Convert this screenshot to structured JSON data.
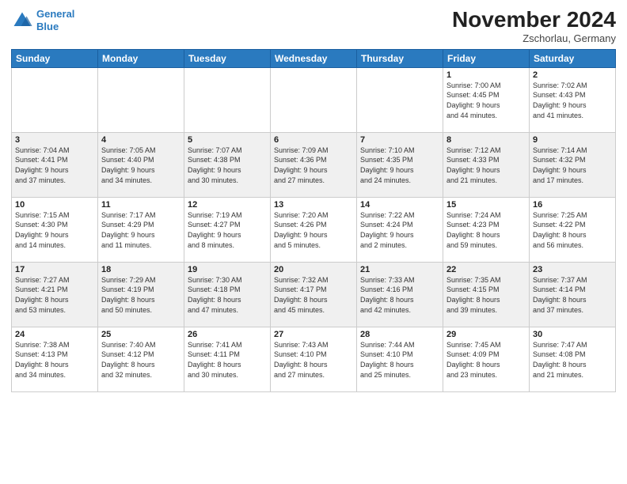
{
  "header": {
    "logo_line1": "General",
    "logo_line2": "Blue",
    "month_title": "November 2024",
    "location": "Zschorlau, Germany"
  },
  "weekdays": [
    "Sunday",
    "Monday",
    "Tuesday",
    "Wednesday",
    "Thursday",
    "Friday",
    "Saturday"
  ],
  "weeks": [
    [
      {
        "day": "",
        "info": ""
      },
      {
        "day": "",
        "info": ""
      },
      {
        "day": "",
        "info": ""
      },
      {
        "day": "",
        "info": ""
      },
      {
        "day": "",
        "info": ""
      },
      {
        "day": "1",
        "info": "Sunrise: 7:00 AM\nSunset: 4:45 PM\nDaylight: 9 hours\nand 44 minutes."
      },
      {
        "day": "2",
        "info": "Sunrise: 7:02 AM\nSunset: 4:43 PM\nDaylight: 9 hours\nand 41 minutes."
      }
    ],
    [
      {
        "day": "3",
        "info": "Sunrise: 7:04 AM\nSunset: 4:41 PM\nDaylight: 9 hours\nand 37 minutes."
      },
      {
        "day": "4",
        "info": "Sunrise: 7:05 AM\nSunset: 4:40 PM\nDaylight: 9 hours\nand 34 minutes."
      },
      {
        "day": "5",
        "info": "Sunrise: 7:07 AM\nSunset: 4:38 PM\nDaylight: 9 hours\nand 30 minutes."
      },
      {
        "day": "6",
        "info": "Sunrise: 7:09 AM\nSunset: 4:36 PM\nDaylight: 9 hours\nand 27 minutes."
      },
      {
        "day": "7",
        "info": "Sunrise: 7:10 AM\nSunset: 4:35 PM\nDaylight: 9 hours\nand 24 minutes."
      },
      {
        "day": "8",
        "info": "Sunrise: 7:12 AM\nSunset: 4:33 PM\nDaylight: 9 hours\nand 21 minutes."
      },
      {
        "day": "9",
        "info": "Sunrise: 7:14 AM\nSunset: 4:32 PM\nDaylight: 9 hours\nand 17 minutes."
      }
    ],
    [
      {
        "day": "10",
        "info": "Sunrise: 7:15 AM\nSunset: 4:30 PM\nDaylight: 9 hours\nand 14 minutes."
      },
      {
        "day": "11",
        "info": "Sunrise: 7:17 AM\nSunset: 4:29 PM\nDaylight: 9 hours\nand 11 minutes."
      },
      {
        "day": "12",
        "info": "Sunrise: 7:19 AM\nSunset: 4:27 PM\nDaylight: 9 hours\nand 8 minutes."
      },
      {
        "day": "13",
        "info": "Sunrise: 7:20 AM\nSunset: 4:26 PM\nDaylight: 9 hours\nand 5 minutes."
      },
      {
        "day": "14",
        "info": "Sunrise: 7:22 AM\nSunset: 4:24 PM\nDaylight: 9 hours\nand 2 minutes."
      },
      {
        "day": "15",
        "info": "Sunrise: 7:24 AM\nSunset: 4:23 PM\nDaylight: 8 hours\nand 59 minutes."
      },
      {
        "day": "16",
        "info": "Sunrise: 7:25 AM\nSunset: 4:22 PM\nDaylight: 8 hours\nand 56 minutes."
      }
    ],
    [
      {
        "day": "17",
        "info": "Sunrise: 7:27 AM\nSunset: 4:21 PM\nDaylight: 8 hours\nand 53 minutes."
      },
      {
        "day": "18",
        "info": "Sunrise: 7:29 AM\nSunset: 4:19 PM\nDaylight: 8 hours\nand 50 minutes."
      },
      {
        "day": "19",
        "info": "Sunrise: 7:30 AM\nSunset: 4:18 PM\nDaylight: 8 hours\nand 47 minutes."
      },
      {
        "day": "20",
        "info": "Sunrise: 7:32 AM\nSunset: 4:17 PM\nDaylight: 8 hours\nand 45 minutes."
      },
      {
        "day": "21",
        "info": "Sunrise: 7:33 AM\nSunset: 4:16 PM\nDaylight: 8 hours\nand 42 minutes."
      },
      {
        "day": "22",
        "info": "Sunrise: 7:35 AM\nSunset: 4:15 PM\nDaylight: 8 hours\nand 39 minutes."
      },
      {
        "day": "23",
        "info": "Sunrise: 7:37 AM\nSunset: 4:14 PM\nDaylight: 8 hours\nand 37 minutes."
      }
    ],
    [
      {
        "day": "24",
        "info": "Sunrise: 7:38 AM\nSunset: 4:13 PM\nDaylight: 8 hours\nand 34 minutes."
      },
      {
        "day": "25",
        "info": "Sunrise: 7:40 AM\nSunset: 4:12 PM\nDaylight: 8 hours\nand 32 minutes."
      },
      {
        "day": "26",
        "info": "Sunrise: 7:41 AM\nSunset: 4:11 PM\nDaylight: 8 hours\nand 30 minutes."
      },
      {
        "day": "27",
        "info": "Sunrise: 7:43 AM\nSunset: 4:10 PM\nDaylight: 8 hours\nand 27 minutes."
      },
      {
        "day": "28",
        "info": "Sunrise: 7:44 AM\nSunset: 4:10 PM\nDaylight: 8 hours\nand 25 minutes."
      },
      {
        "day": "29",
        "info": "Sunrise: 7:45 AM\nSunset: 4:09 PM\nDaylight: 8 hours\nand 23 minutes."
      },
      {
        "day": "30",
        "info": "Sunrise: 7:47 AM\nSunset: 4:08 PM\nDaylight: 8 hours\nand 21 minutes."
      }
    ]
  ]
}
